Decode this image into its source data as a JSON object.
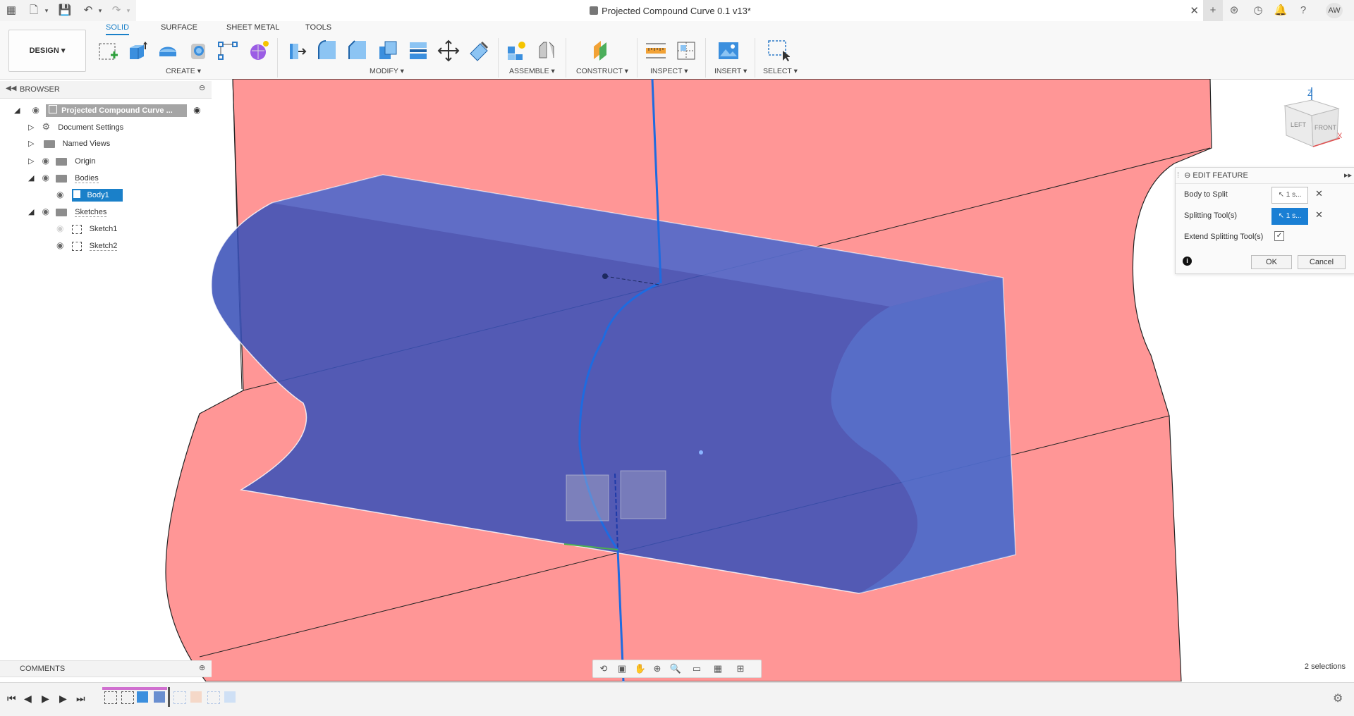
{
  "titlebar": {
    "title": "Projected Compound Curve 0.1 v13*",
    "user_initials": "AW"
  },
  "ribbon": {
    "workspace": "DESIGN",
    "tabs": [
      "SOLID",
      "SURFACE",
      "SHEET METAL",
      "TOOLS"
    ],
    "groups": {
      "create": "CREATE",
      "modify": "MODIFY",
      "assemble": "ASSEMBLE",
      "construct": "CONSTRUCT",
      "inspect": "INSPECT",
      "insert": "INSERT",
      "select": "SELECT"
    }
  },
  "browser": {
    "title": "BROWSER",
    "root": "Projected Compound Curve ...",
    "items": {
      "document_settings": "Document Settings",
      "named_views": "Named Views",
      "origin": "Origin",
      "bodies": "Bodies",
      "body1": "Body1",
      "sketches": "Sketches",
      "sketch1": "Sketch1",
      "sketch2": "Sketch2"
    }
  },
  "viewcube": {
    "top": "Z",
    "left": "LEFT",
    "front": "FRONT",
    "x": "X"
  },
  "edit_feature": {
    "title": "EDIT FEATURE",
    "body_to_split_label": "Body to Split",
    "body_to_split_value": "1 s...",
    "splitting_tools_label": "Splitting Tool(s)",
    "splitting_tools_value": "1 s...",
    "extend_label": "Extend Splitting Tool(s)",
    "extend_checked": true,
    "ok": "OK",
    "cancel": "Cancel"
  },
  "comments": {
    "title": "COMMENTS"
  },
  "status": {
    "selections": "2 selections"
  },
  "colors": {
    "accent": "#1a7fd4",
    "plane": "#ff9696",
    "body": "#4a66c4",
    "axis": "#1e6be0"
  }
}
